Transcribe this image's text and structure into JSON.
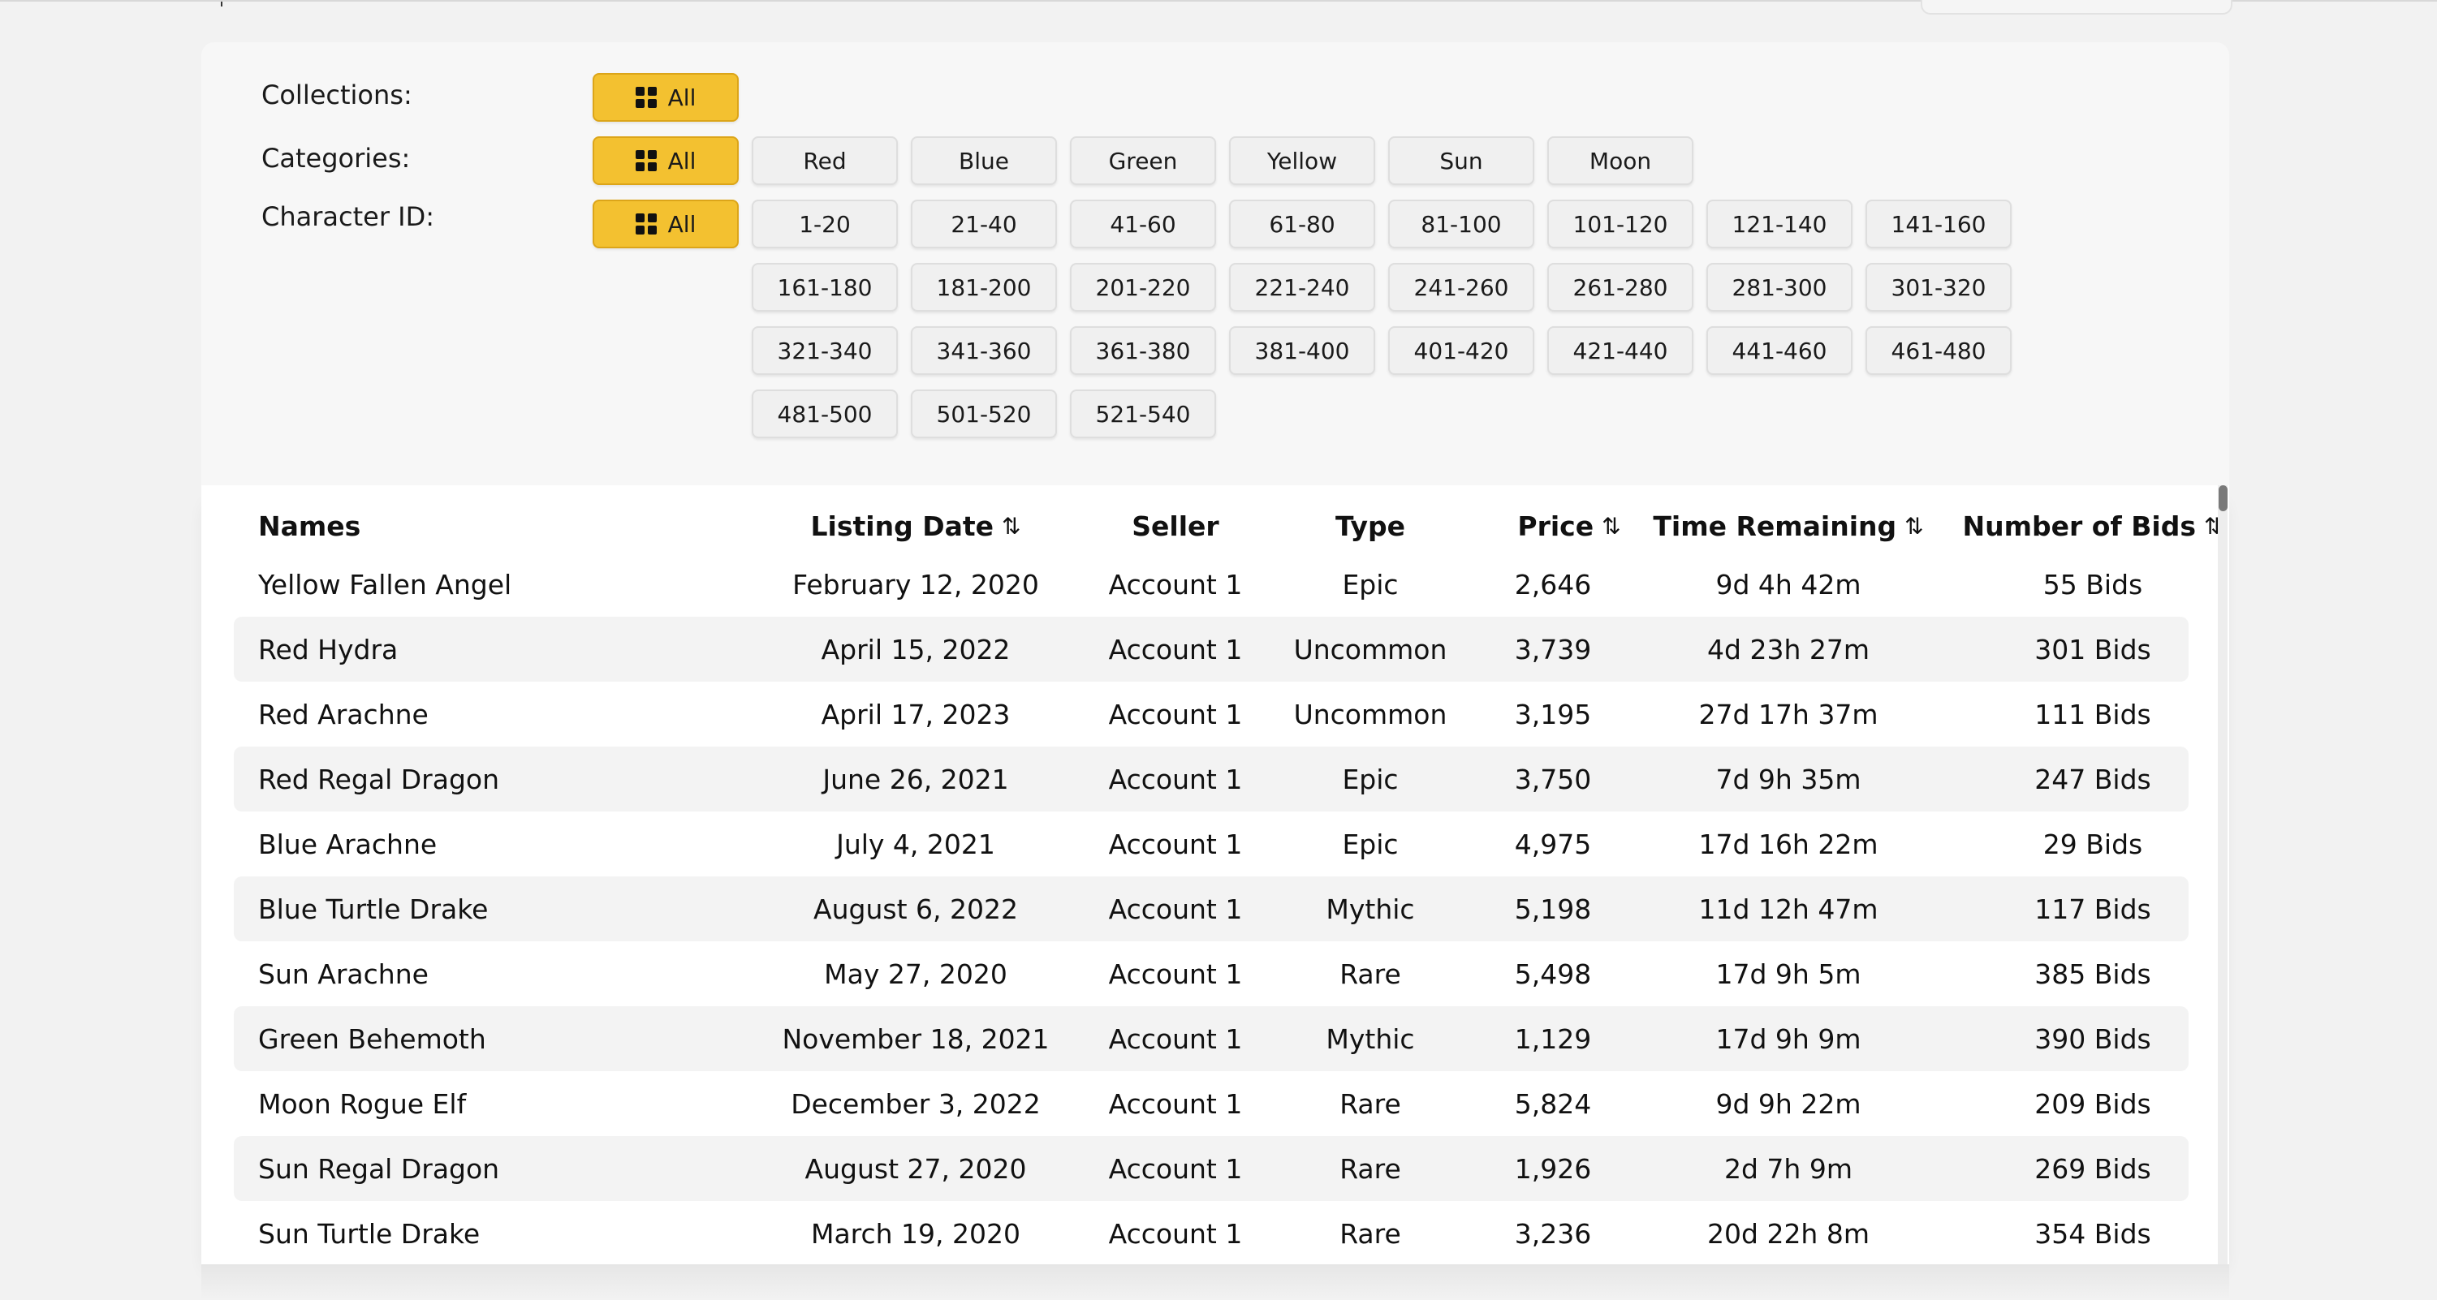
{
  "filters": {
    "collections": {
      "label": "Collections:",
      "all_label": "All",
      "options": []
    },
    "categories": {
      "label": "Categories:",
      "all_label": "All",
      "options": [
        "Red",
        "Blue",
        "Green",
        "Yellow",
        "Sun",
        "Moon"
      ]
    },
    "character_id": {
      "label": "Character ID:",
      "all_label": "All",
      "options": [
        "1-20",
        "21-40",
        "41-60",
        "61-80",
        "81-100",
        "101-120",
        "121-140",
        "141-160",
        "161-180",
        "181-200",
        "201-220",
        "221-240",
        "241-260",
        "261-280",
        "281-300",
        "301-320",
        "321-340",
        "341-360",
        "361-380",
        "381-400",
        "401-420",
        "421-440",
        "441-460",
        "461-480",
        "481-500",
        "501-520",
        "521-540"
      ]
    }
  },
  "table": {
    "columns": [
      {
        "key": "name",
        "label": "Names",
        "sortable": false
      },
      {
        "key": "date",
        "label": "Listing Date",
        "sortable": true
      },
      {
        "key": "seller",
        "label": "Seller",
        "sortable": false
      },
      {
        "key": "type",
        "label": "Type",
        "sortable": false
      },
      {
        "key": "price",
        "label": "Price",
        "sortable": true
      },
      {
        "key": "time",
        "label": "Time Remaining",
        "sortable": true
      },
      {
        "key": "bids",
        "label": "Number of Bids",
        "sortable": true
      }
    ],
    "sort_icon": "sort-arrows-icon",
    "sort_glyph": "⇅",
    "rows": [
      {
        "name": "Yellow Fallen Angel",
        "date": "February 12, 2020",
        "seller": "Account 1",
        "type": "Epic",
        "price": "2,646",
        "time": "9d 4h 42m",
        "bids": "55 Bids"
      },
      {
        "name": "Red Hydra",
        "date": "April 15, 2022",
        "seller": "Account 1",
        "type": "Uncommon",
        "price": "3,739",
        "time": "4d 23h 27m",
        "bids": "301 Bids"
      },
      {
        "name": "Red Arachne",
        "date": "April 17, 2023",
        "seller": "Account 1",
        "type": "Uncommon",
        "price": "3,195",
        "time": "27d 17h 37m",
        "bids": "111 Bids"
      },
      {
        "name": "Red Regal Dragon",
        "date": "June 26, 2021",
        "seller": "Account 1",
        "type": "Epic",
        "price": "3,750",
        "time": "7d 9h 35m",
        "bids": "247 Bids"
      },
      {
        "name": "Blue Arachne",
        "date": "July 4, 2021",
        "seller": "Account 1",
        "type": "Epic",
        "price": "4,975",
        "time": "17d 16h 22m",
        "bids": "29 Bids"
      },
      {
        "name": "Blue Turtle Drake",
        "date": "August 6, 2022",
        "seller": "Account 1",
        "type": "Mythic",
        "price": "5,198",
        "time": "11d 12h 47m",
        "bids": "117 Bids"
      },
      {
        "name": "Sun Arachne",
        "date": "May 27, 2020",
        "seller": "Account 1",
        "type": "Rare",
        "price": "5,498",
        "time": "17d 9h 5m",
        "bids": "385 Bids"
      },
      {
        "name": "Green Behemoth",
        "date": "November 18, 2021",
        "seller": "Account 1",
        "type": "Mythic",
        "price": "1,129",
        "time": "17d 9h 9m",
        "bids": "390 Bids"
      },
      {
        "name": "Moon Rogue Elf",
        "date": "December 3, 2022",
        "seller": "Account 1",
        "type": "Rare",
        "price": "5,824",
        "time": "9d 9h 22m",
        "bids": "209 Bids"
      },
      {
        "name": "Sun Regal Dragon",
        "date": "August 27, 2020",
        "seller": "Account 1",
        "type": "Rare",
        "price": "1,926",
        "time": "2d 7h 9m",
        "bids": "269 Bids"
      },
      {
        "name": "Sun Turtle Drake",
        "date": "March 19, 2020",
        "seller": "Account 1",
        "type": "Rare",
        "price": "3,236",
        "time": "20d 22h 8m",
        "bids": "354 Bids"
      }
    ]
  },
  "colors": {
    "accent": "#f3c130",
    "row_shade": "#f3f3f3",
    "panel_bg": "#f7f7f7"
  }
}
